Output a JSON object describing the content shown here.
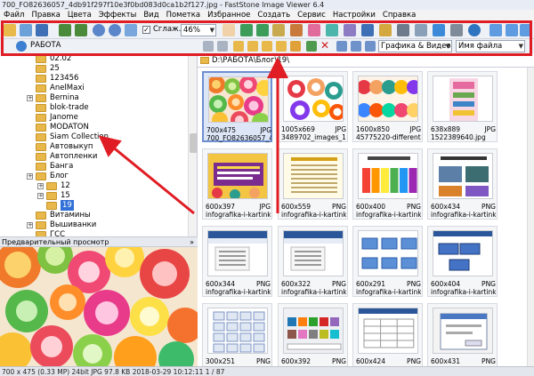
{
  "window": {
    "title": "700_FO82636057_4db91f297f10e3f0bd083d0ca1b2f127.jpg - FastStone Image Viewer 6.4"
  },
  "menu": [
    "Файл",
    "Правка",
    "Цвета",
    "Эффекты",
    "Вид",
    "Пометка",
    "Избранное",
    "Создать",
    "Сервис",
    "Настройки",
    "Справка"
  ],
  "toolbar": {
    "smooth_label": "Сглаж.",
    "zoom_value": "46%",
    "filter_value": "Графика & Видео",
    "sort_value": "Имя файла",
    "folder_value": "РАБОТА"
  },
  "tree": [
    {
      "label": "02.02",
      "expander": false
    },
    {
      "label": "25",
      "expander": false
    },
    {
      "label": "123456",
      "expander": false
    },
    {
      "label": "AnelMaxi",
      "expander": false
    },
    {
      "label": "Bernina",
      "expander": true
    },
    {
      "label": "blok-trade",
      "expander": false
    },
    {
      "label": "Janome",
      "expander": false
    },
    {
      "label": "MODATON",
      "expander": false
    },
    {
      "label": "Siam Collection",
      "expander": false
    },
    {
      "label": "Автовыкуп",
      "expander": false
    },
    {
      "label": "Автопленки",
      "expander": false
    },
    {
      "label": "Банга",
      "expander": false
    },
    {
      "label": "Блог",
      "expander": true
    },
    {
      "label": "12",
      "expander": true
    },
    {
      "label": "15",
      "expander": true
    },
    {
      "label": "19",
      "expander": false
    },
    {
      "label": "Витамины",
      "expander": false
    },
    {
      "label": "Вышиванки",
      "expander": true
    },
    {
      "label": "ГСС",
      "expander": false
    }
  ],
  "preview": {
    "header": "Предварительный просмотр"
  },
  "path": "D:\\РАБОТА\\Блог\\19\\",
  "thumbnails": [
    {
      "size": "700x475",
      "type": "JPG",
      "name": "700_FO82636057_4d...",
      "kind": "candy",
      "selected": true
    },
    {
      "size": "1005x669",
      "type": "JPG",
      "name": "3489702_images_18...",
      "kind": "candy2",
      "selected": false
    },
    {
      "size": "1600x850",
      "type": "JPG",
      "name": "45775220-different-f...",
      "kind": "candy3",
      "selected": false
    },
    {
      "size": "638x889",
      "type": "JPG",
      "name": "1522389640.jpg",
      "kind": "infopink",
      "selected": false
    },
    {
      "size": "600x397",
      "type": "JPG",
      "name": "infografika-i-kartinki...",
      "kind": "infocandy",
      "selected": false
    },
    {
      "size": "600x559",
      "type": "PNG",
      "name": "infografika-i-kartinki...",
      "kind": "doc",
      "selected": false
    },
    {
      "size": "600x400",
      "type": "PNG",
      "name": "infografika-i-kartinki...",
      "kind": "infocolor",
      "selected": false
    },
    {
      "size": "600x434",
      "type": "PNG",
      "name": "infografika-i-kartinki...",
      "kind": "printers",
      "selected": false
    },
    {
      "size": "600x344",
      "type": "PNG",
      "name": "infografika-i-kartinki...",
      "kind": "word",
      "selected": false
    },
    {
      "size": "600x322",
      "type": "PNG",
      "name": "infografika-i-kartinki...",
      "kind": "word",
      "selected": false
    },
    {
      "size": "600x291",
      "type": "PNG",
      "name": "infografika-i-kartinki...",
      "kind": "boxes",
      "selected": false
    },
    {
      "size": "600x404",
      "type": "PNG",
      "name": "infografika-i-kartinki...",
      "kind": "boxes2",
      "selected": false
    },
    {
      "size": "300x251",
      "type": "PNG",
      "name": "",
      "kind": "grid",
      "selected": false
    },
    {
      "size": "600x392",
      "type": "PNG",
      "name": "",
      "kind": "palette",
      "selected": false
    },
    {
      "size": "600x424",
      "type": "PNG",
      "name": "",
      "kind": "table",
      "selected": false
    },
    {
      "size": "600x431",
      "type": "PNG",
      "name": "",
      "kind": "dialog",
      "selected": false
    }
  ],
  "status": {
    "text": "700 x 475 (0.33 MP)  24bit  JPG  97.8 KB  2018-03-29 10:12:11  1 / 87"
  },
  "colors": {
    "highlight": "#e01c24",
    "selection": "#dce6f7"
  }
}
